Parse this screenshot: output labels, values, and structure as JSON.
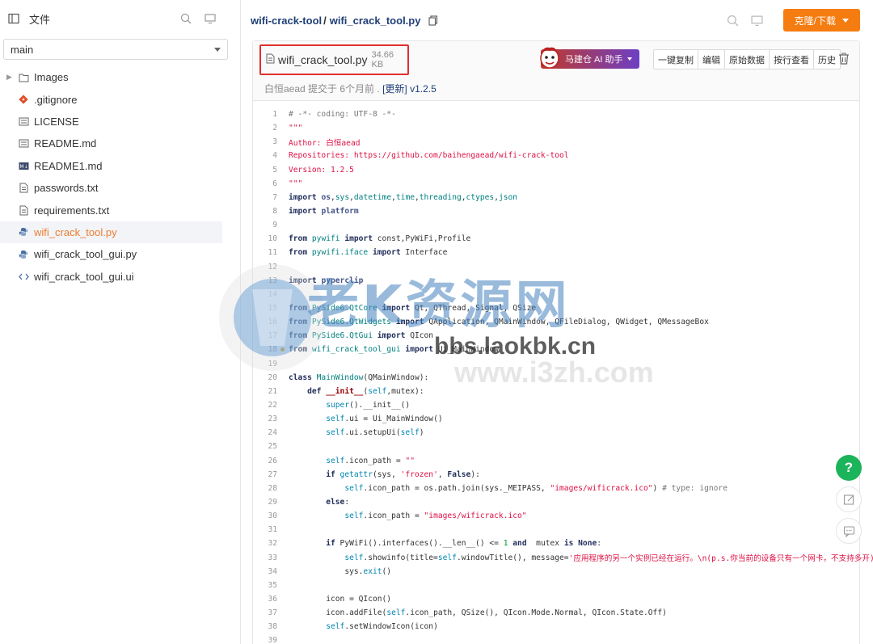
{
  "sidebar": {
    "title": "文件",
    "branch": "main",
    "items": [
      {
        "label": "Images",
        "kind": "folder"
      },
      {
        "label": ".gitignore",
        "kind": "git"
      },
      {
        "label": "LICENSE",
        "kind": "text"
      },
      {
        "label": "README.md",
        "kind": "text"
      },
      {
        "label": "README1.md",
        "kind": "markdown"
      },
      {
        "label": "passwords.txt",
        "kind": "file"
      },
      {
        "label": "requirements.txt",
        "kind": "file"
      },
      {
        "label": "wifi_crack_tool.py",
        "kind": "python",
        "active": true
      },
      {
        "label": "wifi_crack_tool_gui.py",
        "kind": "python"
      },
      {
        "label": "wifi_crack_tool_gui.ui",
        "kind": "code"
      }
    ]
  },
  "header": {
    "repo": "wifi-crack-tool",
    "separator": "/",
    "file": "wifi_crack_tool.py",
    "clone_label": "克隆/下载"
  },
  "file": {
    "name": "wifi_crack_tool.py",
    "size": "34.66 KB",
    "commit_author": "白恒aead",
    "commit_text": "提交于 6个月前 .",
    "commit_link": "[更新]",
    "commit_version": "v1.2.5",
    "ai_label": "马建仓 AI 助手",
    "actions": [
      "一键复制",
      "编辑",
      "原始数据",
      "按行查看",
      "历史"
    ]
  },
  "watermark": {
    "title": "老K资源网",
    "url1": "bbs.laokbk.cn",
    "url2": "www.i3zh.com"
  },
  "floating": {
    "help": "?"
  },
  "colors": {
    "accent": "#f57c10",
    "link": "#1f3f77",
    "help": "#1bb45a",
    "highlight": "#e03030"
  },
  "code": [
    [
      [
        "cm",
        "# -*- coding: UTF-8 -*-"
      ]
    ],
    [
      [
        "st",
        "\"\"\""
      ]
    ],
    [
      [
        "st",
        "Author: 白恒aead"
      ]
    ],
    [
      [
        "st",
        "Repositories: https://github.com/baihengaead/wifi-crack-tool"
      ]
    ],
    [
      [
        "st",
        "Version: 1.2.5"
      ]
    ],
    [
      [
        "st",
        "\"\"\""
      ]
    ],
    [
      [
        "kw",
        "import "
      ],
      [
        "md",
        "os"
      ],
      [
        "src",
        ","
      ],
      [
        "ty",
        "sys"
      ],
      [
        "src",
        ","
      ],
      [
        "ty",
        "datetime"
      ],
      [
        "src",
        ","
      ],
      [
        "ty",
        "time"
      ],
      [
        "src",
        ","
      ],
      [
        "ty",
        "threading"
      ],
      [
        "src",
        ","
      ],
      [
        "ty",
        "ctypes"
      ],
      [
        "src",
        ","
      ],
      [
        "ty",
        "json"
      ]
    ],
    [
      [
        "kw",
        "import "
      ],
      [
        "md",
        "platform"
      ]
    ],
    [],
    [
      [
        "kw",
        "from "
      ],
      [
        "ty",
        "pywifi"
      ],
      [
        "kw",
        " import "
      ],
      [
        "src",
        "const,PyWiFi,Profile"
      ]
    ],
    [
      [
        "kw",
        "from "
      ],
      [
        "ty",
        "pywifi.iface"
      ],
      [
        "kw",
        " import "
      ],
      [
        "src",
        "Interface"
      ]
    ],
    [],
    [
      [
        "kw",
        "import "
      ],
      [
        "md",
        "pyperclip"
      ]
    ],
    [],
    [
      [
        "kw",
        "from "
      ],
      [
        "ty",
        "PySide6.QtCore"
      ],
      [
        "kw",
        " import "
      ],
      [
        "src",
        "Qt, QThread, Signal, QSize"
      ]
    ],
    [
      [
        "kw",
        "from "
      ],
      [
        "ty",
        "PySide6.QtWidgets"
      ],
      [
        "kw",
        " import "
      ],
      [
        "src",
        "QApplication, QMainWindow, QFileDialog, QWidget, QMessageBox"
      ]
    ],
    [
      [
        "kw",
        "from "
      ],
      [
        "ty",
        "PySide6.QtGui"
      ],
      [
        "kw",
        " import "
      ],
      [
        "src",
        "QIcon"
      ]
    ],
    [
      [
        "kw",
        "from "
      ],
      [
        "ty",
        "wifi_crack_tool_gui"
      ],
      [
        "kw",
        " import "
      ],
      [
        "src",
        "Ui_MainWindow"
      ]
    ],
    [],
    [
      [
        "kw",
        "class "
      ],
      [
        "ty",
        "MainWindow"
      ],
      [
        "src",
        "(QMainWindow):"
      ]
    ],
    [
      [
        "src",
        "    "
      ],
      [
        "kw",
        "def "
      ],
      [
        "fn2",
        "__init__"
      ],
      [
        "src",
        "("
      ],
      [
        "bi",
        "self"
      ],
      [
        "src",
        ",mutex):"
      ]
    ],
    [
      [
        "src",
        "        "
      ],
      [
        "bi",
        "super"
      ],
      [
        "src",
        "().__init__()"
      ]
    ],
    [
      [
        "src",
        "        "
      ],
      [
        "bi",
        "self"
      ],
      [
        "src",
        ".ui = Ui_MainWindow()"
      ]
    ],
    [
      [
        "src",
        "        "
      ],
      [
        "bi",
        "self"
      ],
      [
        "src",
        ".ui.setupUi("
      ],
      [
        "bi",
        "self"
      ],
      [
        "src",
        ")"
      ]
    ],
    [],
    [
      [
        "src",
        "        "
      ],
      [
        "bi",
        "self"
      ],
      [
        "src",
        ".icon_path = "
      ],
      [
        "st",
        "\"\""
      ]
    ],
    [
      [
        "src",
        "        "
      ],
      [
        "kw",
        "if "
      ],
      [
        "bi",
        "getattr"
      ],
      [
        "src",
        "(sys, "
      ],
      [
        "st",
        "'frozen'"
      ],
      [
        "src",
        ", "
      ],
      [
        "kw",
        "False"
      ],
      [
        "src",
        "):"
      ]
    ],
    [
      [
        "src",
        "            "
      ],
      [
        "bi",
        "self"
      ],
      [
        "src",
        ".icon_path = os.path.join(sys._MEIPASS, "
      ],
      [
        "st",
        "\"images/wificrack.ico\""
      ],
      [
        "src",
        ") "
      ],
      [
        "cm",
        "# type: ignore"
      ]
    ],
    [
      [
        "src",
        "        "
      ],
      [
        "kw",
        "else"
      ],
      [
        "src",
        ":"
      ]
    ],
    [
      [
        "src",
        "            "
      ],
      [
        "bi",
        "self"
      ],
      [
        "src",
        ".icon_path = "
      ],
      [
        "st",
        "\"images/wificrack.ico\""
      ]
    ],
    [],
    [
      [
        "src",
        "        "
      ],
      [
        "kw",
        "if "
      ],
      [
        "src",
        "PyWiFi().interfaces().__len__() <= "
      ],
      [
        "nm",
        "1"
      ],
      [
        "kw",
        " and "
      ],
      [
        "src",
        " mutex "
      ],
      [
        "kw",
        "is None"
      ],
      [
        "src",
        ":"
      ]
    ],
    [
      [
        "src",
        "            "
      ],
      [
        "bi",
        "self"
      ],
      [
        "src",
        ".showinfo(title="
      ],
      [
        "bi",
        "self"
      ],
      [
        "src",
        ".windowTitle(), message="
      ],
      [
        "st",
        "'应用程序的另一个实例已经在运行。\\n(p.s.你当前的设备只有一个网卡，不支持多开)'"
      ]
    ],
    [
      [
        "src",
        "            "
      ],
      [
        "src",
        "sys."
      ],
      [
        "bi",
        "exit"
      ],
      [
        "src",
        "()"
      ]
    ],
    [],
    [
      [
        "src",
        "        "
      ],
      [
        "src",
        "icon = QIcon()"
      ]
    ],
    [
      [
        "src",
        "        "
      ],
      [
        "src",
        "icon.addFile("
      ],
      [
        "bi",
        "self"
      ],
      [
        "src",
        ".icon_path, QSize(), QIcon.Mode.Normal, QIcon.State.Off)"
      ]
    ],
    [
      [
        "src",
        "        "
      ],
      [
        "bi",
        "self"
      ],
      [
        "src",
        ".setWindowIcon(icon)"
      ]
    ],
    []
  ]
}
